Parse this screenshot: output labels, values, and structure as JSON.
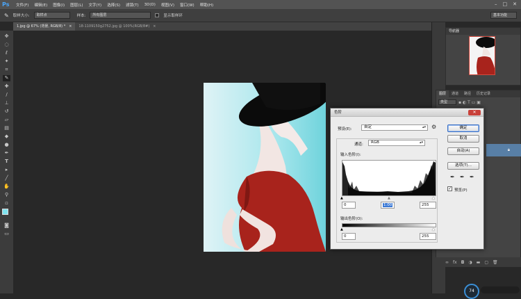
{
  "app": {
    "logo": "Ps"
  },
  "menubar": {
    "items": [
      "文件(F)",
      "编辑(E)",
      "图像(I)",
      "图层(L)",
      "文字(Y)",
      "选择(S)",
      "滤镜(T)",
      "3D(D)",
      "视图(V)",
      "窗口(W)",
      "帮助(H)"
    ],
    "window_buttons": [
      "–",
      "□",
      "✕"
    ]
  },
  "options_bar": {
    "tool_icon": "eyedropper-icon",
    "sample_size_label": "取样大小:",
    "sample_size_value": "取样点",
    "sample_label": "样本:",
    "sample_value": "所有图层",
    "show_ring_label": "显示取样环",
    "workspace": "基本功能"
  },
  "doc_tabs": [
    {
      "title": "1.jpg @ 67% (背景, RGB/8) *",
      "close": "×"
    },
    {
      "title": "18-1109150g2752.jpg @ 100%(RGB/8#)",
      "close": "×"
    }
  ],
  "panels": {
    "navigator_tab": "导航器",
    "layers_tabs": [
      "图层",
      "通道",
      "路径",
      "历史记录"
    ],
    "layers_kind": "类型"
  },
  "levels_dialog": {
    "title": "色阶",
    "preset_label": "预设(E):",
    "preset_value": "自定",
    "channel_label": "通道:",
    "channel_value": "RGB",
    "input_levels_label": "输入色阶(I):",
    "input_black": "0",
    "input_gamma": "1.00",
    "input_white": "255",
    "output_levels_label": "输出色阶(O):",
    "output_black": "0",
    "output_white": "255",
    "buttons": {
      "ok": "确定",
      "cancel": "取消",
      "auto": "自动(A)",
      "options": "选项(T)..."
    },
    "preview_label": "预览(P)",
    "preview_checked": true
  },
  "zoom_widget": {
    "value": "74"
  },
  "colors": {
    "accent": "#4ba5f7",
    "dress": "#a8231c",
    "background_cyan": "#7fd4de",
    "selected_layer": "#587fa6"
  }
}
